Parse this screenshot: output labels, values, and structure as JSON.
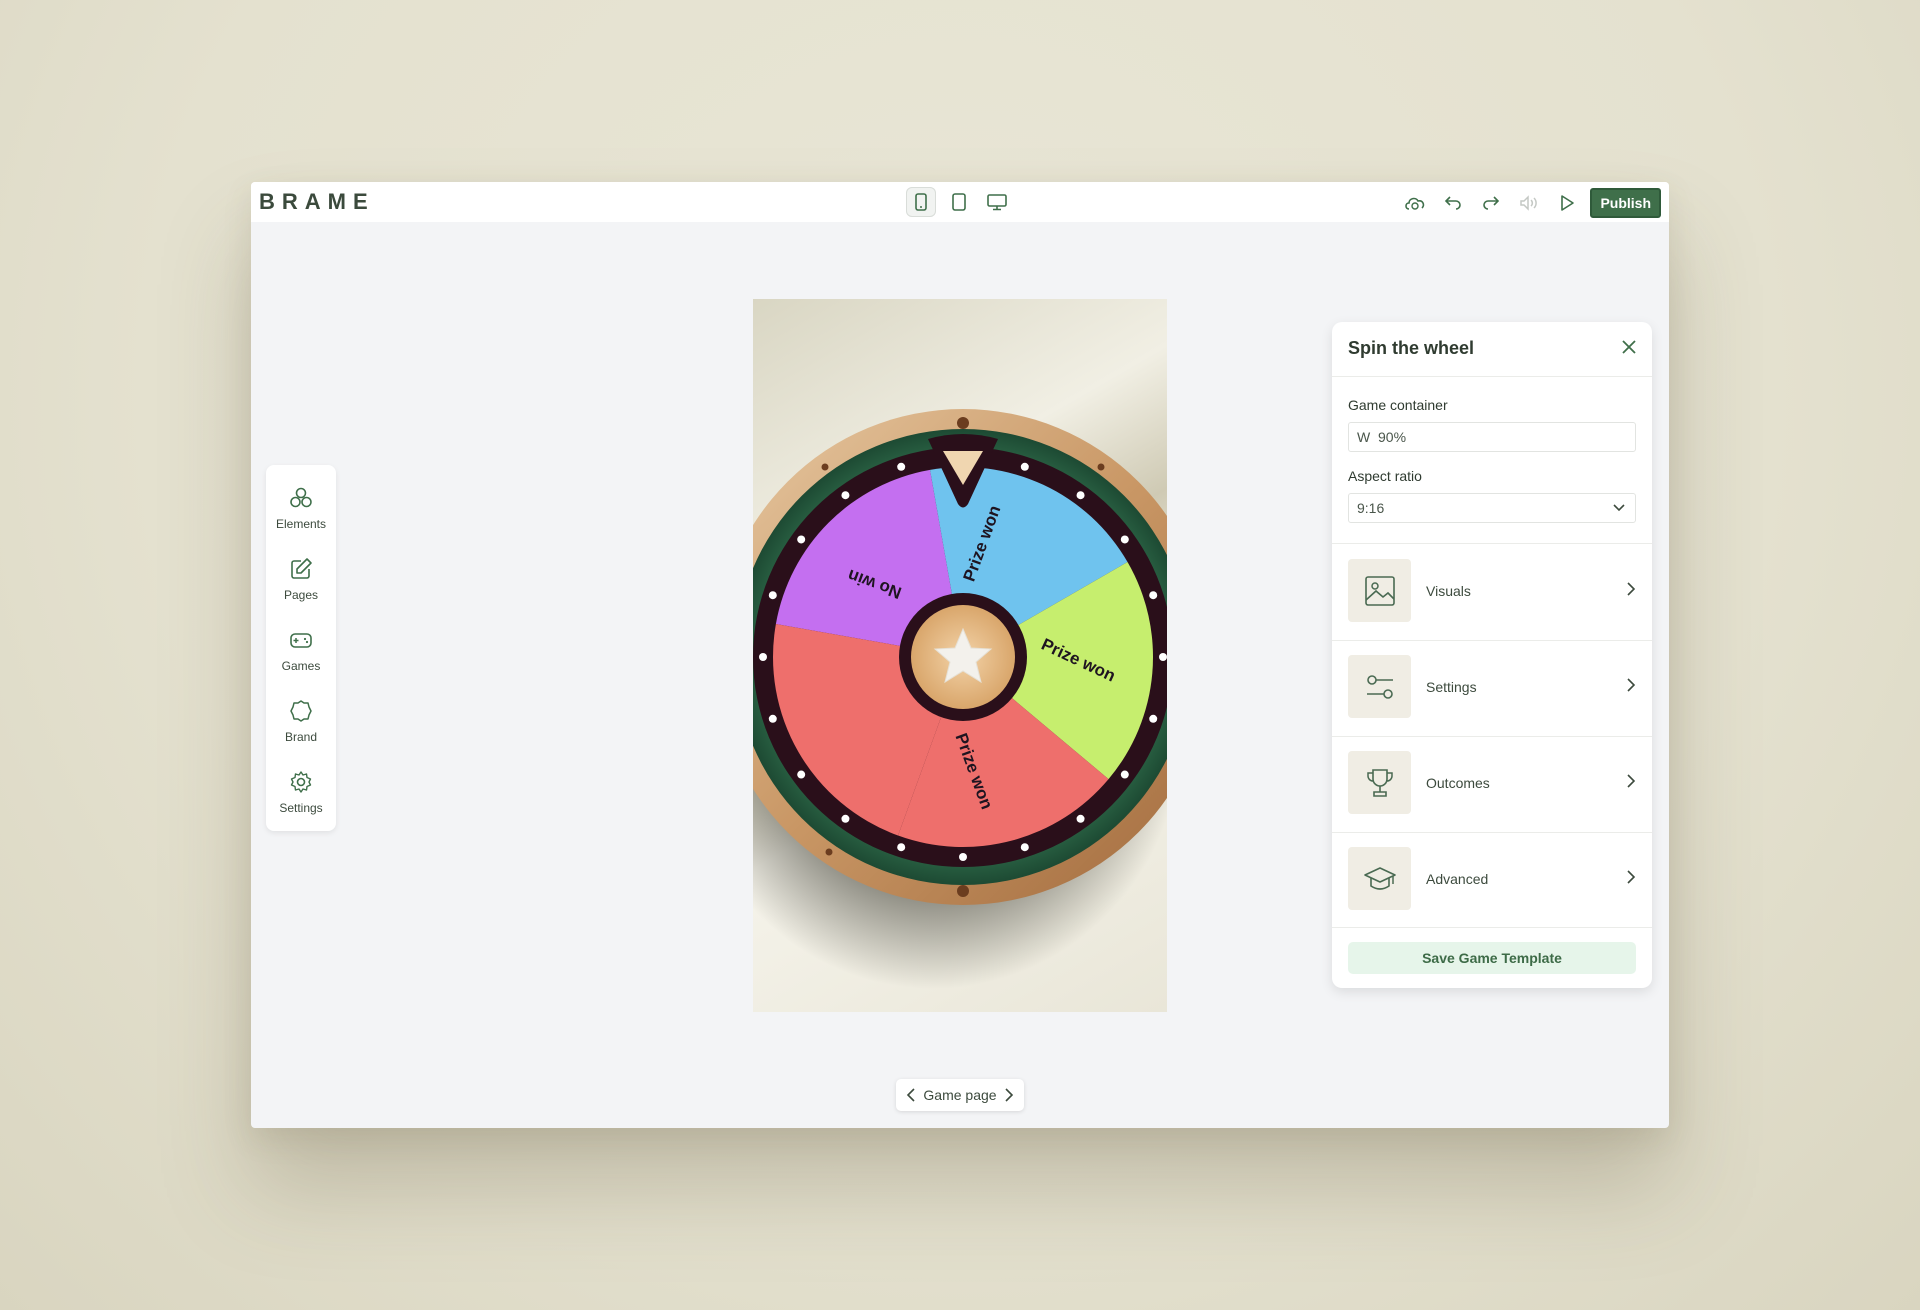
{
  "app": {
    "logo": "BRAME"
  },
  "toolbar": {
    "devices": [
      {
        "name": "mobile",
        "active": true
      },
      {
        "name": "tablet",
        "active": false
      },
      {
        "name": "desktop",
        "active": false
      }
    ],
    "publish_label": "Publish"
  },
  "sidebar": {
    "items": [
      {
        "label": "Elements",
        "icon": "elements-icon"
      },
      {
        "label": "Pages",
        "icon": "edit-icon"
      },
      {
        "label": "Games",
        "icon": "gamepad-icon"
      },
      {
        "label": "Brand",
        "icon": "badge-icon"
      },
      {
        "label": "Settings",
        "icon": "gear-icon"
      }
    ]
  },
  "wheel": {
    "segments": [
      {
        "label": "Prize won",
        "color": "#c46ff0"
      },
      {
        "label": "Prize won",
        "color": "#6fc3ee"
      },
      {
        "label": "Prize won",
        "color": "#c6ee6e"
      },
      {
        "label": "No win",
        "color": "#ee6f6c"
      }
    ],
    "center_icon": "star-icon"
  },
  "panel": {
    "title": "Spin the wheel",
    "game_container_label": "Game container",
    "width_prefix": "W",
    "width_value": "90%",
    "aspect_ratio_label": "Aspect ratio",
    "aspect_ratio_value": "9:16",
    "rows": [
      {
        "label": "Visuals",
        "icon": "image-icon"
      },
      {
        "label": "Settings",
        "icon": "sliders-icon"
      },
      {
        "label": "Outcomes",
        "icon": "trophy-icon"
      },
      {
        "label": "Advanced",
        "icon": "graduation-cap-icon"
      }
    ],
    "save_label": "Save Game Template"
  },
  "pager": {
    "label": "Game page"
  },
  "colors": {
    "accent": "#3f6f4a",
    "save_bg": "#e6f5ea"
  }
}
